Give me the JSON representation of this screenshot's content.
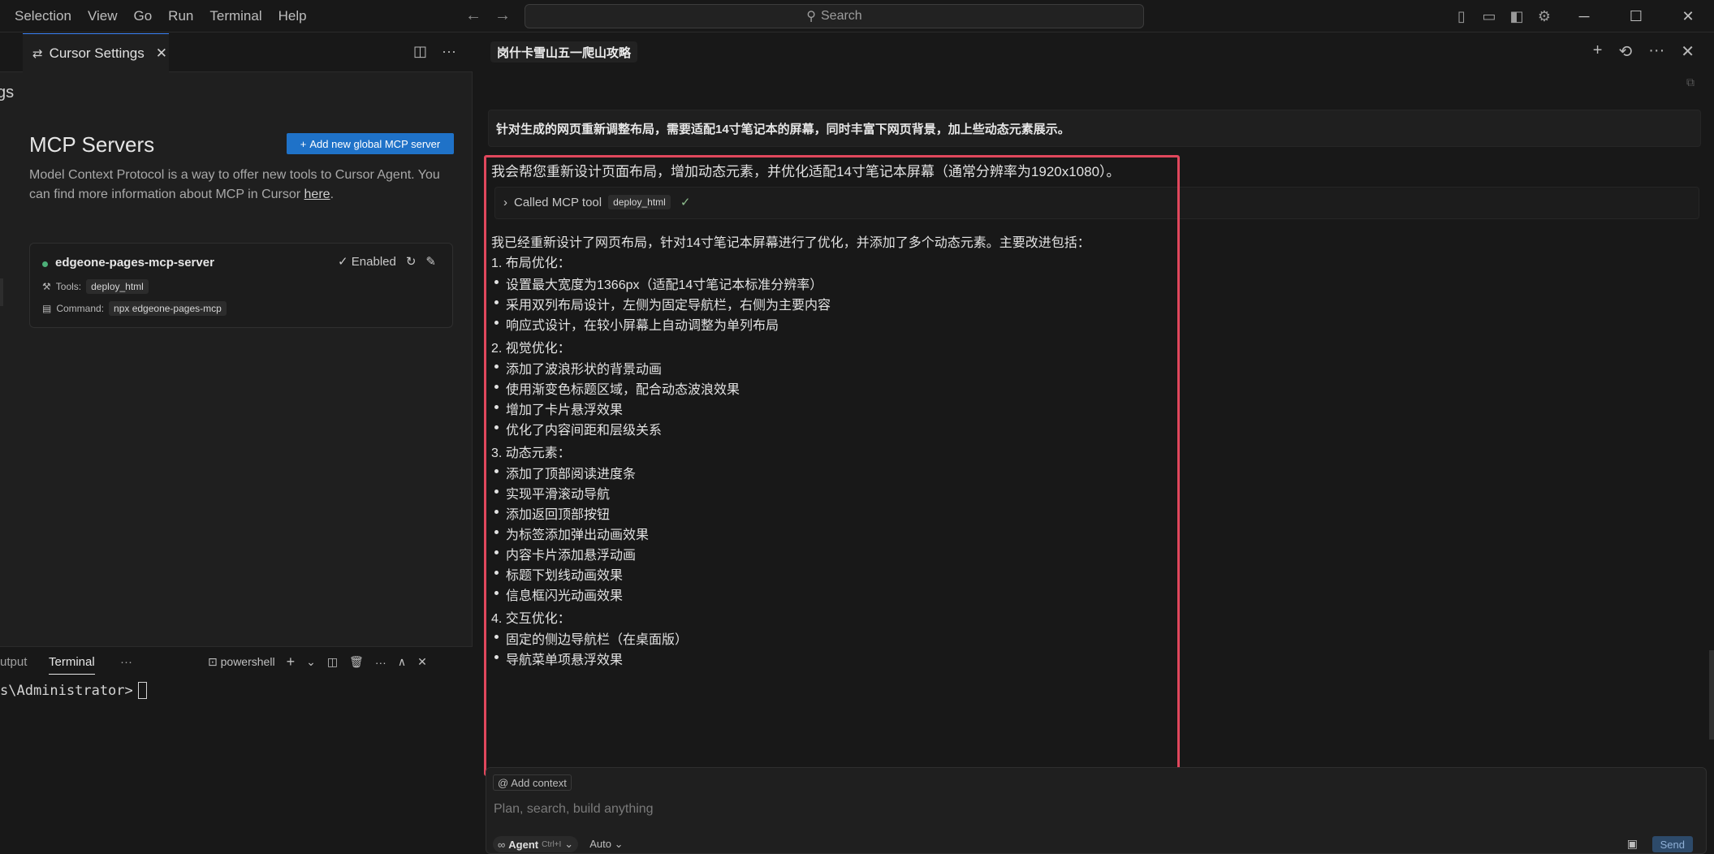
{
  "menu": [
    "Selection",
    "View",
    "Go",
    "Run",
    "Terminal",
    "Help"
  ],
  "search": {
    "label": "Search"
  },
  "left": {
    "tab_label": "Cursor Settings",
    "settings_heading": "gs",
    "mcp_title": "MCP Servers",
    "add_button": "Add new global MCP server",
    "desc": "Model Context Protocol is a way to offer new tools to Cursor Agent. You can find more information about MCP in Cursor ",
    "desc_link": "here",
    "desc_end": ".",
    "server": {
      "name": "edgeone-pages-mcp-server",
      "status": "Enabled",
      "tools_label": "Tools:",
      "tool": "deploy_html",
      "command_label": "Command:",
      "command": "npx edgeone-pages-mcp"
    }
  },
  "terminal": {
    "tab_output": "utput",
    "tab_terminal": "Terminal",
    "more": "···",
    "shell": "powershell",
    "prompt": "s\\Administrator>"
  },
  "chat": {
    "title": "岗什卡雪山五一爬山攻略",
    "user_message": "针对生成的网页重新调整布局，需要适配14寸笔记本的屏幕，同时丰富下网页背景，加上些动态元素展示。",
    "intro": "我会帮您重新设计页面布局，增加动态元素，并优化适配14寸笔记本屏幕（通常分辨率为1920x1080）。",
    "tool_call": {
      "label": "Called MCP tool",
      "tool": "deploy_html"
    },
    "lines": [
      {
        "text": "我已经重新设计了网页布局，针对14寸笔记本屏幕进行了优化，并添加了多个动态元素。主要改进包括：",
        "bullet": false
      },
      {
        "text": "1. 布局优化：",
        "bullet": false
      },
      {
        "text": "设置最大宽度为1366px（适配14寸笔记本标准分辨率）",
        "bullet": true
      },
      {
        "text": "采用双列布局设计，左侧为固定导航栏，右侧为主要内容",
        "bullet": true
      },
      {
        "text": "响应式设计，在较小屏幕上自动调整为单列布局",
        "bullet": true
      },
      {
        "text": "2. 视觉优化：",
        "bullet": false
      },
      {
        "text": "添加了波浪形状的背景动画",
        "bullet": true
      },
      {
        "text": "使用渐变色标题区域，配合动态波浪效果",
        "bullet": true
      },
      {
        "text": "增加了卡片悬浮效果",
        "bullet": true
      },
      {
        "text": "优化了内容间距和层级关系",
        "bullet": true
      },
      {
        "text": "3. 动态元素：",
        "bullet": false
      },
      {
        "text": "添加了顶部阅读进度条",
        "bullet": true
      },
      {
        "text": "实现平滑滚动导航",
        "bullet": true
      },
      {
        "text": "添加返回顶部按钮",
        "bullet": true
      },
      {
        "text": "为标签添加弹出动画效果",
        "bullet": true
      },
      {
        "text": "内容卡片添加悬浮动画",
        "bullet": true
      },
      {
        "text": "标题下划线动画效果",
        "bullet": true
      },
      {
        "text": "信息框闪光动画效果",
        "bullet": true
      },
      {
        "text": "4. 交互优化：",
        "bullet": false
      },
      {
        "text": "固定的侧边导航栏（在桌面版）",
        "bullet": true
      },
      {
        "text": "导航菜单项悬浮效果",
        "bullet": true
      }
    ]
  },
  "composer": {
    "add_context": "Add context",
    "placeholder": "Plan, search, build anything",
    "mode": "Agent",
    "mode_shortcut": "Ctrl+I",
    "model": "Auto",
    "send": "Send"
  },
  "colors": {
    "highlight": "#e0475c",
    "accent": "#1f72c8",
    "enabled_dot": "#4caf78"
  },
  "icons": [
    "search-icon",
    "back-arrow-icon",
    "forward-arrow-icon",
    "settings-icon",
    "close-icon",
    "split-editor-icon",
    "more-icon",
    "refresh-icon",
    "edit-icon",
    "check-icon",
    "plus-icon",
    "history-icon",
    "copy-icon",
    "chevron-right-icon",
    "image-icon",
    "trash-icon",
    "terminal-icon",
    "at-icon",
    "infinity-icon"
  ]
}
